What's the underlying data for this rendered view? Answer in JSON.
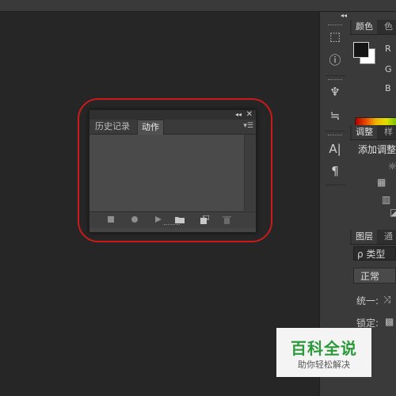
{
  "floating_panel": {
    "tabs": [
      "历史记录",
      "动作"
    ],
    "active_tab": "动作",
    "collapse_glyph": "◂◂",
    "close_glyph": "✕",
    "menu_glyph": "▾☰",
    "bottom_icons": [
      "stop-icon",
      "record-icon",
      "play-icon",
      "folder-icon",
      "new-action-icon",
      "trash-icon"
    ]
  },
  "toolstrip": {
    "collapse_glyph": "◂◂",
    "icons": [
      "3d-icon",
      "info-icon",
      "brush-presets-icon",
      "adjust-sliders-icon",
      "character-icon",
      "paragraph-icon"
    ]
  },
  "color_panel": {
    "tabs": [
      "颜色",
      "色"
    ],
    "channels": [
      "R",
      "G",
      "B"
    ],
    "foreground": "#151515",
    "background": "#ffffff"
  },
  "adjustments_panel": {
    "tabs": [
      "调整",
      "样"
    ],
    "title": "添加调整"
  },
  "layers_panel": {
    "tabs": [
      "图层",
      "通"
    ],
    "search": "ρ 类型",
    "blend_mode": "正常",
    "unify_label": "统一:",
    "lock_label": "锁定:"
  },
  "watermark": {
    "title": "百科全说",
    "subtitle": "助你轻松解决"
  },
  "accent": {
    "highlight": "#cc1a1a",
    "watermark_green": "#2c9a3a"
  }
}
